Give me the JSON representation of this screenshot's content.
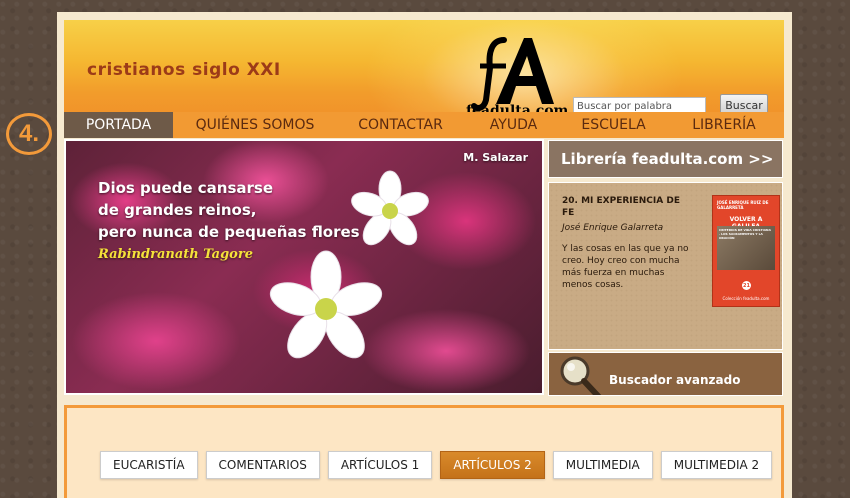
{
  "step_badge": "4.",
  "header": {
    "site_title": "cristianos siglo XXI",
    "logo_text": "feadulta.com",
    "search_placeholder": "Buscar por palabra",
    "search_button": "Buscar"
  },
  "nav": [
    {
      "label": "PORTADA",
      "active": true
    },
    {
      "label": "QUIÉNES SOMOS",
      "active": false
    },
    {
      "label": "CONTACTAR",
      "active": false
    },
    {
      "label": "AYUDA",
      "active": false
    },
    {
      "label": "ESCUELA",
      "active": false
    },
    {
      "label": "LIBRERÍA",
      "active": false
    }
  ],
  "hero": {
    "credit": "M. Salazar",
    "quote_lines": [
      "Dios puede cansarse",
      "de grandes reinos,",
      "pero nunca de pequeñas flores"
    ],
    "author": "Rabindranath Tagore"
  },
  "sidebar": {
    "banner": "Librería feadulta.com >>",
    "article": {
      "title": "20. MI EXPERIENCIA DE FE",
      "author": "José Enrique Galarreta",
      "excerpt": "Y las cosas en las que ya no creo. Hoy creo con mucha más fuerza en muchas menos cosas."
    },
    "book": {
      "top_text": "JOSÉ ENRIQUE RUIZ DE GALARRETA",
      "title": "VOLVER A GALILEA",
      "subtitle": "CRITERIOS DE VIDA CRISTIANA · LOS SACRAMENTOS Y LA ORACIÓN",
      "number": "21",
      "footer": "Colección feadulta.com"
    },
    "advanced_search": "Buscador avanzado"
  },
  "tabs": [
    {
      "label": "EUCARISTÍA",
      "active": false
    },
    {
      "label": "COMENTARIOS",
      "active": false
    },
    {
      "label": "ARTÍCULOS 1",
      "active": false
    },
    {
      "label": "ARTÍCULOS 2",
      "active": true
    },
    {
      "label": "MULTIMEDIA",
      "active": false
    },
    {
      "label": "MULTIMEDIA 2",
      "active": false
    }
  ],
  "colors": {
    "accent": "#f29a33",
    "nav_active": "#6e5a48",
    "tab_active": "#c97a20",
    "title_text": "#9c3b18"
  }
}
